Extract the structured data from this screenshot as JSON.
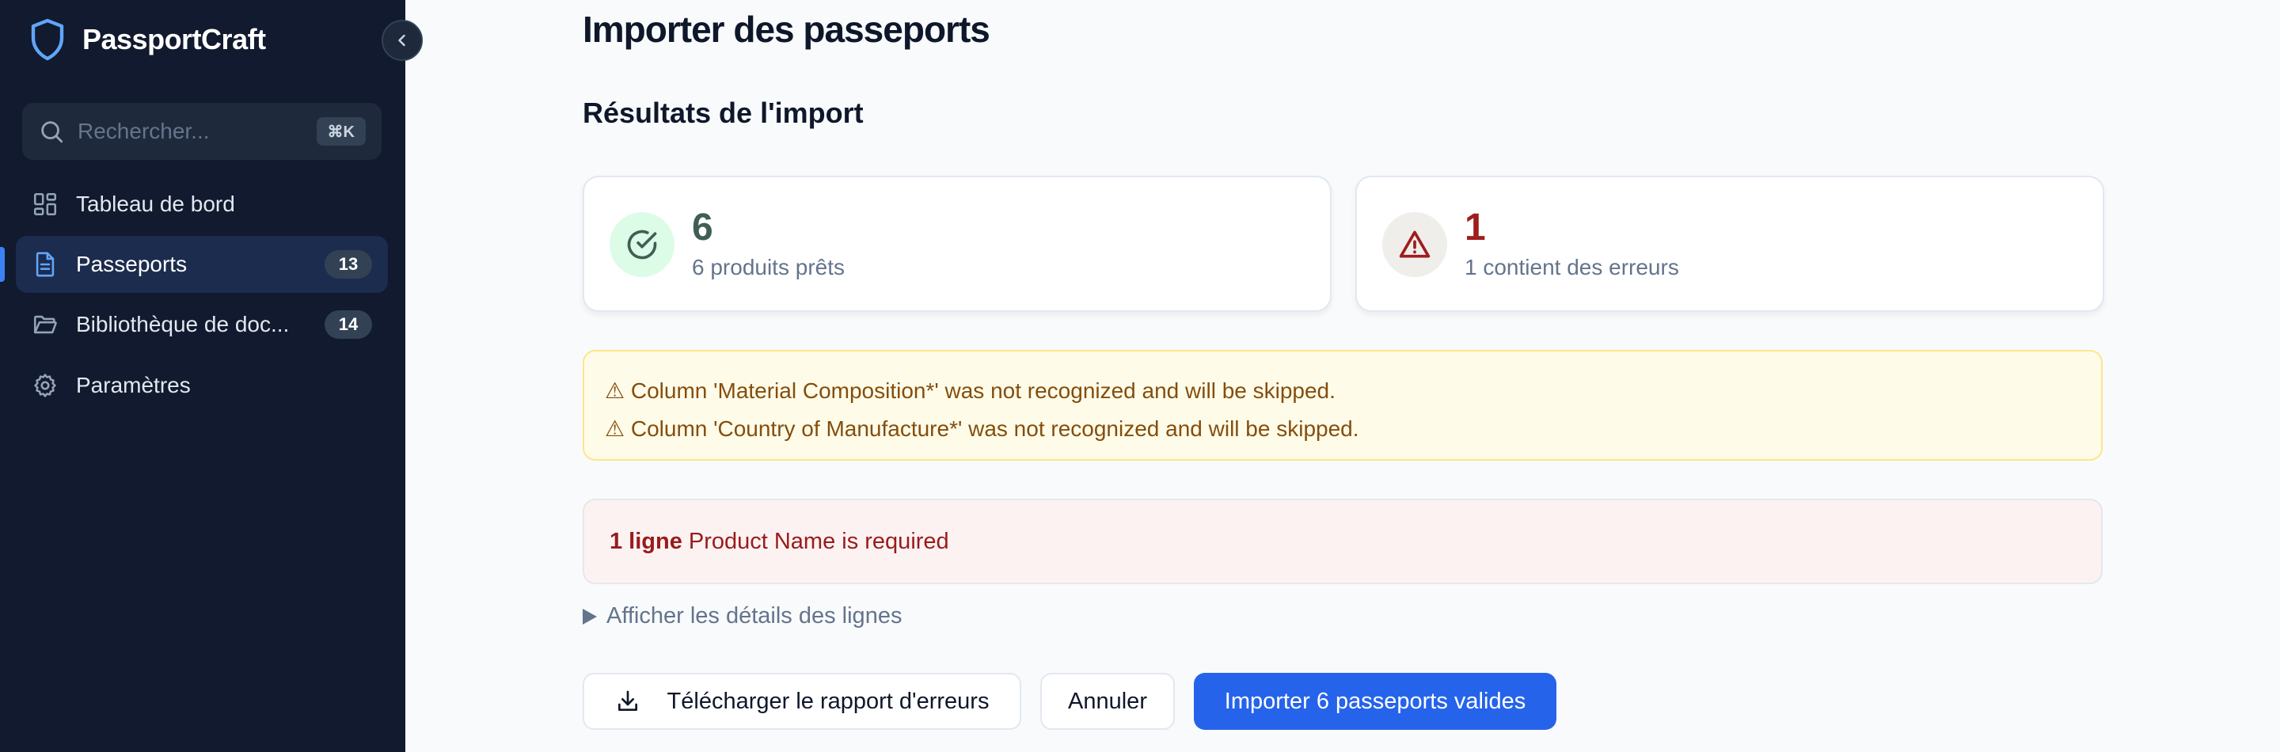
{
  "sidebar": {
    "brand": "PassportCraft",
    "search": {
      "placeholder": "Rechercher...",
      "shortcut": "⌘K"
    },
    "items": [
      {
        "label": "Tableau de bord",
        "icon": "dashboard-icon"
      },
      {
        "label": "Passeports",
        "icon": "document-icon",
        "badge": "13",
        "active": true
      },
      {
        "label": "Bibliothèque de doc...",
        "icon": "folder-icon",
        "badge": "14"
      },
      {
        "label": "Paramètres",
        "icon": "gear-icon"
      }
    ]
  },
  "main": {
    "title": "Importer des passeports",
    "results_title": "Résultats de l'import",
    "cards": [
      {
        "count": "6",
        "label": "6 produits prêts",
        "color": "#3f5f55",
        "icon": "check-circle-icon"
      },
      {
        "count": "1",
        "label": "1 contient des erreurs",
        "color": "#9f1d1d",
        "icon": "warning-icon"
      }
    ],
    "warnings": [
      "⚠ Column 'Material Composition*' was not recognized and will be skipped.",
      "⚠ Column 'Country of Manufacture*' was not recognized and will be skipped."
    ],
    "error": {
      "count": "1 ligne",
      "message": "Product Name is required"
    },
    "details_toggle": "Afficher les détails des lignes",
    "buttons": {
      "download": "Télécharger le rapport d'erreurs",
      "cancel": "Annuler",
      "import": "Importer 6 passeports valides"
    }
  },
  "colors": {
    "sidebar_bg": "#111a2e",
    "accent": "#2563eb",
    "success": "#3f5f55",
    "danger": "#9f1d1d"
  }
}
